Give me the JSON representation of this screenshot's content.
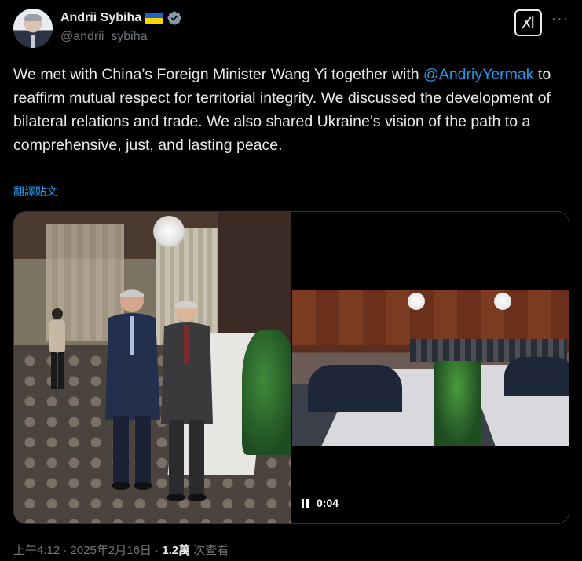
{
  "author": {
    "name": "Andrii Sybiha",
    "handle": "@andrii_sybiha"
  },
  "tweet": {
    "text_before": "We met with China’s Foreign Minister Wang Yi together with ",
    "mention": "@AndriyYermak",
    "text_after": " to reaffirm mutual respect for territorial integrity. We discussed the development of bilateral relations and trade. We also shared Ukraine’s vision of the path to a comprehensive, just, and lasting peace.",
    "translate": "翻譯貼文"
  },
  "video": {
    "time": "0:04"
  },
  "meta": {
    "time": "上午4:12 · 2025年2月16日 · ",
    "views": "1.2萬",
    "views_label": " 次查看"
  },
  "icons": {
    "more": "more-icon",
    "grok": "grok-icon",
    "verified": "verified-badge-icon",
    "flag": "ukraine-flag-icon",
    "pause": "pause-icon"
  },
  "colors": {
    "link": "#1d9bf0",
    "muted": "#71767b",
    "text": "#e7e9ea",
    "background": "#000000"
  }
}
